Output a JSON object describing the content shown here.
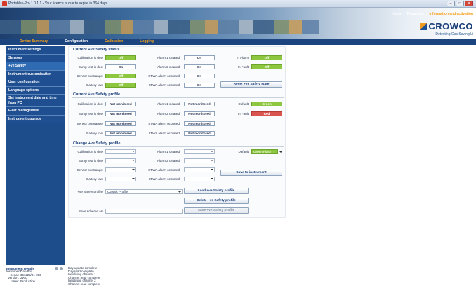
{
  "window": {
    "title": "Portables-Pro 1.0.1.1 - Your licence is due to expire in 364 days",
    "minimize": "–",
    "maximize": "□",
    "close": "✕"
  },
  "topnav": {
    "home": "Home",
    "reporting": "Reporting",
    "info": "Information and activation"
  },
  "brand": {
    "name": "CROWCO",
    "tagline": "Detecting Gas Saving Li"
  },
  "tabs": [
    "Device Summary",
    "Configuration",
    "Calibration",
    "Logging"
  ],
  "sidebar": [
    "Instrument settings",
    "Sensors",
    "+ve Safety",
    "Instrument customisation",
    "User configuration",
    "Language options",
    "Set instrument date and time from PC",
    "Fleet management",
    "Instrument upgrade"
  ],
  "status": {
    "title": "Current +ve Safety status",
    "rows": [
      {
        "l1": "Calibration is due",
        "v1": "Off",
        "l2": "Alarm 1 cleared",
        "v2": "On",
        "l3": "In Alarm",
        "v3": "Off"
      },
      {
        "l1": "Bump test is due",
        "v1": "On",
        "l2": "Alarm 2 cleared",
        "v2": "On",
        "l3": "In Fault",
        "v3": "Off"
      },
      {
        "l1": "Sensor overrange",
        "v1": "Off",
        "l2": "STWA alarm occurred",
        "v2": "On"
      },
      {
        "l1": "Battery low",
        "v1": "Off",
        "l2": "LTWA alarm occurred",
        "v2": "On"
      }
    ],
    "reset_button": "Reset +ve Safety state"
  },
  "profile": {
    "title": "Current +ve Safety profile",
    "rows": [
      {
        "l1": "Calibration is due",
        "v1": "Not monitored",
        "l2": "Alarm 1 cleared",
        "v2": "Not monitored",
        "l3": "Default",
        "v3": "Green"
      },
      {
        "l1": "Bump test is due",
        "v1": "Not monitored",
        "l2": "Alarm 2 cleared",
        "v2": "Not monitored",
        "l3": "In Fault",
        "v3": "Red"
      },
      {
        "l1": "Sensor overrange",
        "v1": "Not monitored",
        "l2": "STWA alarm occurred",
        "v2": "Not monitored"
      },
      {
        "l1": "Battery low",
        "v1": "Not monitored",
        "l2": "LTWA alarm occurred",
        "v2": "Not monitored"
      }
    ]
  },
  "change": {
    "title": "Change +ve Safety profile",
    "rows": [
      {
        "l1": "Calibration is due",
        "l2": "Alarm 1 cleared",
        "l3": "Default",
        "v3": "Green Flash"
      },
      {
        "l1": "Bump test is due",
        "l2": "Alarm 2 cleared"
      },
      {
        "l1": "Sensor overrange",
        "l2": "STWA alarm occurred"
      },
      {
        "l1": "Battery low",
        "l2": "LTWA alarm occurred"
      }
    ],
    "save_button": "Save to instrument",
    "profile_label": "+ve Safety profile",
    "profile_value": "Classic Profile",
    "save_scheme_label": "Save scheme as",
    "load_button": "Load +ve Safety profile",
    "delete_button": "Delete +ve Safety profile",
    "save_profile_button": "Save +ve Safety profile"
  },
  "details": {
    "title": "Instrument Details",
    "rows": [
      {
        "k": "Instrument:",
        "v": "Gas-Pro"
      },
      {
        "k": "Serial:",
        "v": "361225/01-003"
      },
      {
        "k": "Version:",
        "v": "2v00"
      },
      {
        "k": "User:",
        "v": "Production"
      }
    ]
  },
  "log": [
    "Day update complete",
    "Day read complete",
    "Initialising channel 1",
    "Channel read complete",
    "Initialising channel 2",
    "Channel read complete"
  ],
  "colors": {
    "accent": "#1c4580",
    "brand_orange": "#f4a21a",
    "on_green": "#8dc63f",
    "fault_red": "#d9534f"
  }
}
